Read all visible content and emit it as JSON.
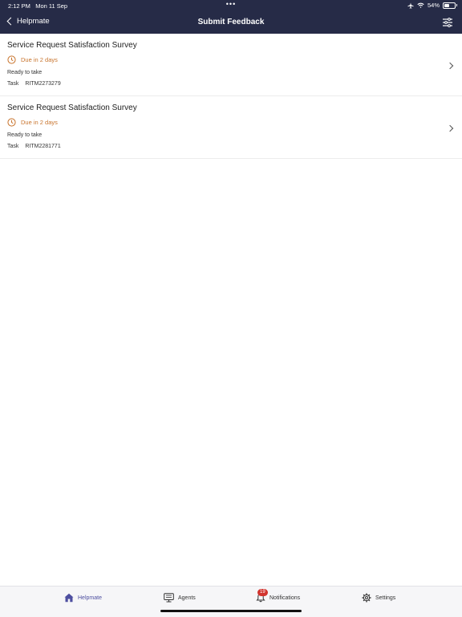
{
  "status_bar": {
    "time": "2:12 PM",
    "date": "Mon 11 Sep",
    "dots": "•••",
    "battery": "54%",
    "battery_level": 0.54
  },
  "nav": {
    "back_label": "Helpmate",
    "title": "Submit Feedback"
  },
  "items": [
    {
      "title": "Service Request Satisfaction Survey",
      "due": "Due in 2 days",
      "status": "Ready to take",
      "task_label": "Task",
      "task_number": "RITM2273279"
    },
    {
      "title": "Service Request Satisfaction Survey",
      "due": "Due in 2 days",
      "status": "Ready to take",
      "task_label": "Task",
      "task_number": "RITM2281771"
    }
  ],
  "tabs": [
    {
      "label": "Helpmate",
      "icon": "home-icon",
      "active": true
    },
    {
      "label": "Agents",
      "icon": "monitor-icon"
    },
    {
      "label": "Notifications",
      "icon": "bell-icon",
      "badge": "19"
    },
    {
      "label": "Settings",
      "icon": "gear-icon"
    }
  ],
  "colors": {
    "nav_bg": "#262b47",
    "due": "#c8742d",
    "tab_active": "#4e4fa0",
    "badge": "#d2352f"
  }
}
